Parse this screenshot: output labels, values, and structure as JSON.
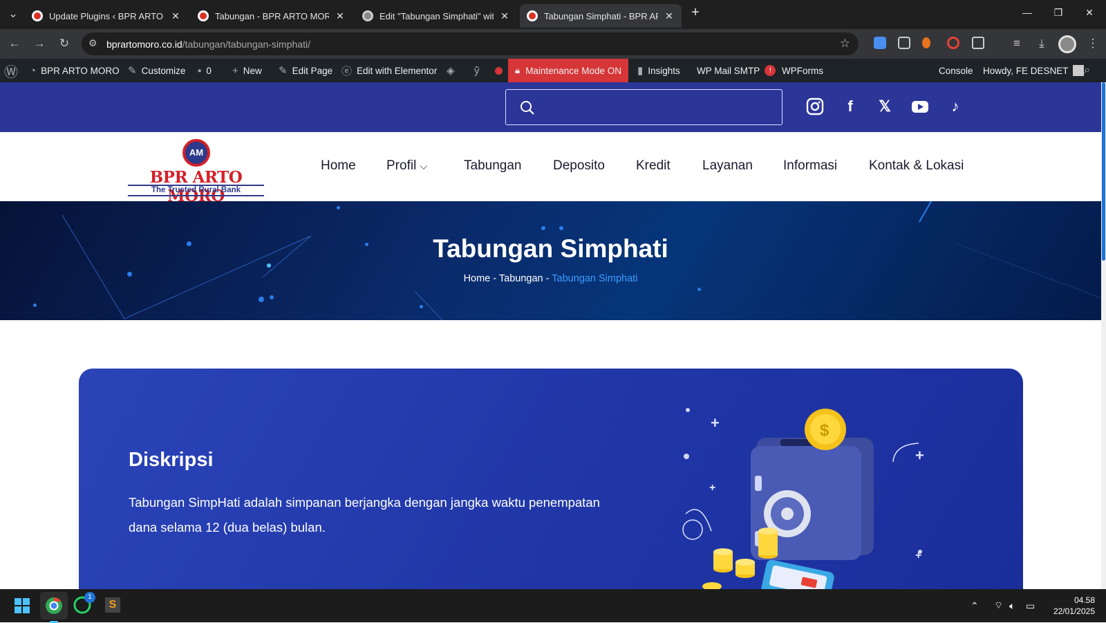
{
  "browser": {
    "tabs": [
      {
        "title": "Update Plugins ‹ BPR ARTO MO",
        "active": false
      },
      {
        "title": "Tabungan - BPR ARTO MORO",
        "active": false
      },
      {
        "title": "Edit \"Tabungan Simphati\" with E",
        "active": false
      },
      {
        "title": "Tabungan Simphati - BPR ARTO",
        "active": true
      }
    ],
    "url_domain": "bprartomoro.co.id",
    "url_path": "/tabungan/tabungan-simphati/"
  },
  "wp_admin_bar": {
    "site_name": "BPR ARTO MORO",
    "customize": "Customize",
    "comments_count": "0",
    "new": "New",
    "edit_page": "Edit Page",
    "edit_elementor": "Edit with Elementor",
    "maintenance": "Maintenance Mode ON",
    "insights": "Insights",
    "wp_mail_smtp": "WP Mail SMTP",
    "smtp_badge": "!",
    "wpforms": "WPForms",
    "console": "Console",
    "howdy": "Howdy, FE DESNET"
  },
  "site": {
    "logo_title": "BPR ARTO MORO",
    "logo_tagline": "The Trusted Rural Bank",
    "logo_mark": "AM",
    "menu": [
      "Home",
      "Profil",
      "Tabungan",
      "Deposito",
      "Kredit",
      "Layanan",
      "Informasi",
      "Kontak & Lokasi"
    ]
  },
  "hero": {
    "title": "Tabungan Simphati",
    "breadcrumb": [
      "Home",
      "Tabungan",
      "Tabungan Simphati"
    ],
    "sep": "-"
  },
  "content": {
    "heading": "Diskripsi",
    "text": "Tabungan SimpHati adalah simpanan berjangka dengan jangka waktu penempatan dana selama 12 (dua belas) bulan."
  },
  "taskbar": {
    "time": "04.58",
    "date": "22/01/2025",
    "whatsapp_badge": "1"
  },
  "colors": {
    "top_strip": "#2c3598",
    "card": "#2137a8",
    "logo_red": "#d42028",
    "breadcrumb_current": "#3b9cff"
  }
}
